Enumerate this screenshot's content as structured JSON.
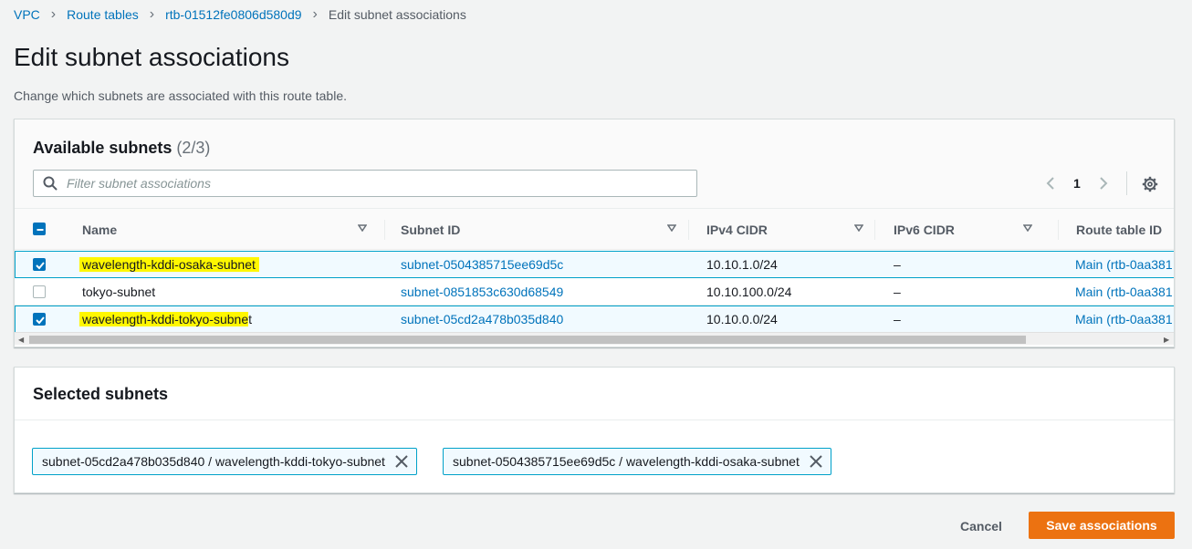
{
  "breadcrumb": {
    "items": [
      "VPC",
      "Route tables",
      "rtb-01512fe0806d580d9"
    ],
    "current": "Edit subnet associations"
  },
  "page": {
    "title": "Edit subnet associations",
    "description": "Change which subnets are associated with this route table."
  },
  "available": {
    "title": "Available subnets",
    "count": "(2/3)",
    "filter_placeholder": "Filter subnet associations",
    "page_number": "1",
    "columns": [
      "Name",
      "Subnet ID",
      "IPv4 CIDR",
      "IPv6 CIDR",
      "Route table ID"
    ],
    "rows": [
      {
        "name": "wavelength-kddi-osaka-subnet",
        "subnet_id": "subnet-0504385715ee69d5c",
        "ipv4": "10.10.1.0/24",
        "ipv6": "–",
        "route_table": "Main (rtb-0aa381",
        "checked": true
      },
      {
        "name": "tokyo-subnet",
        "subnet_id": "subnet-0851853c630d68549",
        "ipv4": "10.10.100.0/24",
        "ipv6": "–",
        "route_table": "Main (rtb-0aa381",
        "checked": false
      },
      {
        "name_highlighted": "wavelength-kddi-tokyo-subne",
        "name_rest": "t",
        "subnet_id": "subnet-05cd2a478b035d840",
        "ipv4": "10.10.0.0/24",
        "ipv6": "–",
        "route_table": "Main (rtb-0aa381",
        "checked": true
      }
    ]
  },
  "selected": {
    "title": "Selected subnets",
    "tokens": [
      "subnet-05cd2a478b035d840 / wavelength-kddi-tokyo-subnet",
      "subnet-0504385715ee69d5c / wavelength-kddi-osaka-subnet"
    ]
  },
  "actions": {
    "cancel": "Cancel",
    "save": "Save associations"
  },
  "colors": {
    "primary": "#ec7211",
    "link": "#0073bb",
    "highlight": "#fff700",
    "selected_border": "#00a1c9"
  }
}
